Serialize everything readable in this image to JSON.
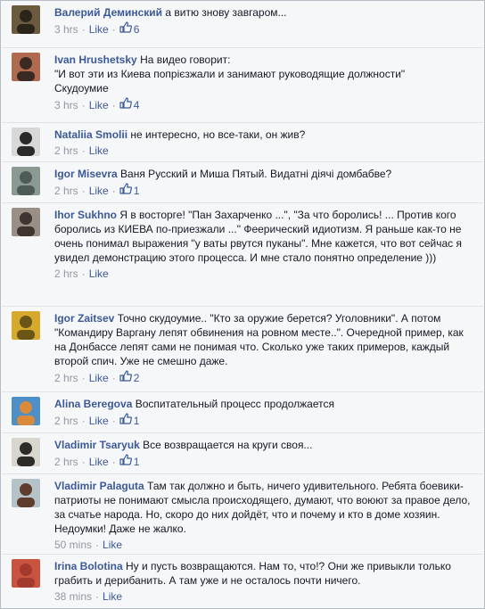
{
  "meta_separator": "·",
  "like_label": "Like",
  "comments": [
    {
      "author": "Валерий Деминский",
      "text": "а витю знову завгаром...",
      "time": "3 hrs",
      "likes": "6",
      "avatar_colors": [
        "#6b5a3e",
        "#2b241a"
      ]
    },
    {
      "author": "Ivan Hrushetsky",
      "text": "На видео говорит:\n\"И вот эти из Киева попрієзжали и занимают руководящие должности\"\nСкудоумие",
      "time": "3 hrs",
      "likes": "4",
      "avatar_colors": [
        "#b06a4f",
        "#3b2a24"
      ]
    },
    {
      "author": "Nataliia Smolii",
      "text": "не интересно, но все-таки, он жив?",
      "time": "2 hrs",
      "likes": "",
      "avatar_colors": [
        "#d8d8d8",
        "#2a2a2a"
      ]
    },
    {
      "author": "Igor Misevra",
      "text": "Ваня Русский и Миша Пятый. Видатні діячі домбабве?",
      "time": "2 hrs",
      "likes": "1",
      "avatar_colors": [
        "#8a9a92",
        "#4e5b57"
      ]
    },
    {
      "author": "Ihor Sukhno",
      "text": "Я в восторге! \"Пан Захарченко ...\", \"За что боролись! ... Против кого боролись из КИЕВА по-приезжали ...\" Феерический идиотизм. Я раньше как-то не очень понимал выражения \"у ваты рвутся пуканы\". Мне кажется, что вот сейчас я увидел демонстрацию этого процесса. И мне стало понятно определение )))",
      "time": "2 hrs",
      "likes": "",
      "avatar_colors": [
        "#9a8f86",
        "#3e3530"
      ]
    },
    {
      "author": "Igor Zaitsev",
      "text": "Точно скудоумие.. \"Кто за оружие берется? Уголовники\". А потом \"Командиру Варгану лепят обвинения на ровном месте..\". Очередной пример, как на Донбассе лепят сами не понимая что. Сколько уже таких примеров, каждый второй спич. Уже не смешно даже.",
      "time": "2 hrs",
      "likes": "2",
      "avatar_colors": [
        "#d6a92c",
        "#6a5516"
      ]
    },
    {
      "author": "Alina Beregova",
      "text": "Воспитательный процесс продолжается",
      "time": "2 hrs",
      "likes": "1",
      "avatar_colors": [
        "#4e8fc8",
        "#d98a3a"
      ]
    },
    {
      "author": "Vladimir Tsaryuk",
      "text": "Все возвращается на круги своя...",
      "time": "2 hrs",
      "likes": "1",
      "avatar_colors": [
        "#d9d6cf",
        "#2e2c29"
      ]
    },
    {
      "author": "Vladimir Palaguta",
      "text": "Там так должно и быть, ничего удивительного. Ребята боевики-патриоты не понимают смысла происходящего, думают, что воюют за правое дело, за счатье народа. Но, скоро до них дойдёт, что и почему и кто в доме хозяин. Недоумки! Даже не жалко.",
      "time": "50 mins",
      "likes": "",
      "avatar_colors": [
        "#b5c2c8",
        "#5e3d2e"
      ]
    },
    {
      "author": "Irina Bolotina",
      "text": "Ну и пусть возвращаются. Нам то, что!? Они же привыкли только грабить и дерибанить. А там уже и не осталось почти ничего.",
      "time": "38 mins",
      "likes": "",
      "avatar_colors": [
        "#c9533e",
        "#a33a2d"
      ]
    }
  ]
}
